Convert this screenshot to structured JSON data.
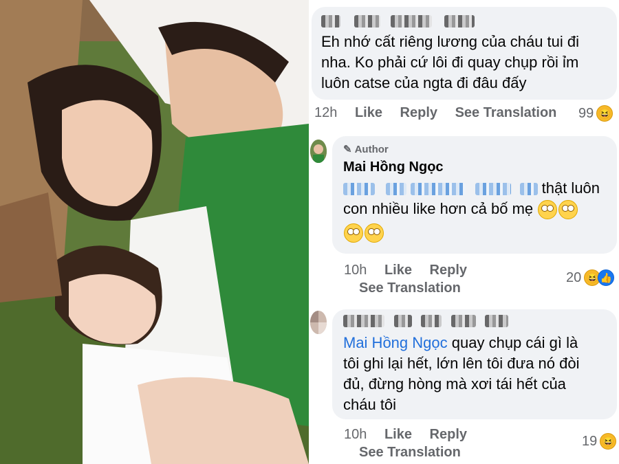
{
  "comments": [
    {
      "author_redacted": true,
      "text_lines": [
        "Eh nhớ cất riêng lương của cháu tui đi",
        "nha. Ko phải cứ lôi đi quay chụp rồi ỉm",
        "luôn catse của ngta đi đâu đấy"
      ],
      "time": "12h",
      "like_label": "Like",
      "reply_label": "Reply",
      "translate_label": "See Translation",
      "reaction_count": "99",
      "reaction_icons": [
        "haha-emoji-icon"
      ]
    },
    {
      "author_badge": "Author",
      "author": "Mai Hồng Ngọc",
      "line1_suffix": "thật luôn",
      "line2": "con nhiều like hơn cả bố mẹ",
      "time": "10h",
      "like_label": "Like",
      "reply_label": "Reply",
      "translate_label": "See Translation",
      "reaction_count": "20",
      "reaction_icons": [
        "haha-emoji-icon",
        "like-emoji-icon"
      ]
    },
    {
      "author_redacted": true,
      "mention": "Mai Hồng Ngọc",
      "line1_rest": "quay chụp cái gì là",
      "line2": "tôi ghi lại hết, lớn lên tôi đưa nó đòi",
      "line3": "đủ, đừng hòng mà xơi tái hết của",
      "line4": "cháu tôi",
      "time": "10h",
      "like_label": "Like",
      "reply_label": "Reply",
      "translate_label": "See Translation",
      "reaction_count": "19",
      "reaction_icons": [
        "haha-emoji-icon"
      ]
    }
  ],
  "colors": {
    "bubble": "#f0f2f5",
    "link": "#216fdb",
    "meta": "#65676b"
  }
}
